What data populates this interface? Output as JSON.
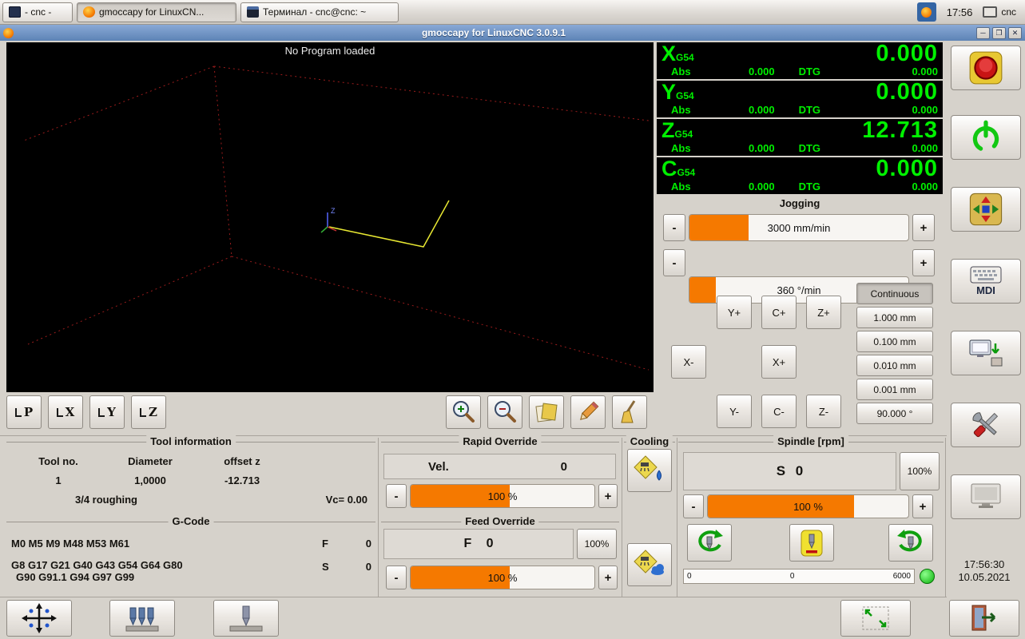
{
  "colors": {
    "accent_orange": "#f57900",
    "dro_green": "#00f000",
    "panel_bg": "#d6d2cb",
    "titlebar_blue": "#5d83b5"
  },
  "symbols": {
    "minus": "-",
    "plus": "+",
    "minimize": "─",
    "restore": "❐",
    "close": "✕"
  },
  "taskbar": {
    "windows": [
      {
        "label": "- cnc -"
      },
      {
        "label": "gmoccapy for LinuxCN..."
      },
      {
        "label": "Терминал - cnc@cnc: ~"
      }
    ],
    "clock": "17:56",
    "user": "cnc"
  },
  "titlebar": {
    "title": "gmoccapy for LinuxCNC  3.0.9.1"
  },
  "preview": {
    "message": "No Program loaded",
    "axis_z_label": "Z",
    "view_buttons": [
      {
        "label": "P"
      },
      {
        "label": "X"
      },
      {
        "label": "Y"
      },
      {
        "label": "Z"
      }
    ]
  },
  "dro": {
    "rows": [
      {
        "axis": "X",
        "system": "G54",
        "main": "0.000",
        "abs_label": "Abs",
        "abs": "0.000",
        "dtg_label": "DTG",
        "dtg": "0.000"
      },
      {
        "axis": "Y",
        "system": "G54",
        "main": "0.000",
        "abs_label": "Abs",
        "abs": "0.000",
        "dtg_label": "DTG",
        "dtg": "0.000"
      },
      {
        "axis": "Z",
        "system": "G54",
        "main": "12.713",
        "abs_label": "Abs",
        "abs": "0.000",
        "dtg_label": "DTG",
        "dtg": "0.000"
      },
      {
        "axis": "C",
        "system": "G54",
        "main": "0.000",
        "abs_label": "Abs",
        "abs": "0.000",
        "dtg_label": "DTG",
        "dtg": "0.000"
      }
    ]
  },
  "jogging": {
    "title": "Jogging",
    "linear_slider": {
      "label": "3000 mm/min",
      "fill_pct": 27
    },
    "angular_slider": {
      "label": "360 °/min",
      "fill_pct": 12
    },
    "jog": {
      "y_plus": "Y+",
      "c_plus": "C+",
      "z_plus": "Z+",
      "x_minus": "X-",
      "x_plus": "X+",
      "y_minus": "Y-",
      "c_minus": "C-",
      "z_minus": "Z-"
    },
    "increments": [
      {
        "label": "Continuous"
      },
      {
        "label": "1.000 mm"
      },
      {
        "label": "0.100 mm"
      },
      {
        "label": "0.010 mm"
      },
      {
        "label": "0.001 mm"
      },
      {
        "label": "90.000 °"
      }
    ]
  },
  "tool_info": {
    "title": "Tool information",
    "headers": {
      "tool_no": "Tool no.",
      "diameter": "Diameter",
      "offset_z": "offset z"
    },
    "tool_no": "1",
    "diameter": "1,0000",
    "offset_z": "-12.713",
    "description": "3/4 roughing",
    "vc": "Vc= 0.00"
  },
  "gcode": {
    "title": "G-Code",
    "m_codes": "M0 M5 M9 M48 M53 M61",
    "g_codes_line1": "G8 G17 G21 G40 G43 G54 G64 G80",
    "g_codes_line2": "G90 G91.1 G94 G97 G99",
    "f_label": "F",
    "f_value": "0",
    "s_label": "S",
    "s_value": "0"
  },
  "rapid_override": {
    "title": "Rapid Override",
    "vel_label": "Vel.",
    "vel_value": "0",
    "slider_label": "100 %",
    "fill_pct": 54
  },
  "feed_override": {
    "title": "Feed Override",
    "display": "F 0",
    "reset_label": "100%",
    "slider_label": "100 %",
    "fill_pct": 54
  },
  "cooling": {
    "title": "Cooling"
  },
  "spindle": {
    "title": "Spindle [rpm]",
    "display": "S 0",
    "reset_label": "100%",
    "slider_label": "100 %",
    "fill_pct": 73,
    "scale_min": "0",
    "scale_current": "0",
    "scale_max": "6000"
  },
  "clock_panel": {
    "time": "17:56:30",
    "date": "10.05.2021"
  },
  "right_panel": {
    "mdi_label": "MDI"
  }
}
